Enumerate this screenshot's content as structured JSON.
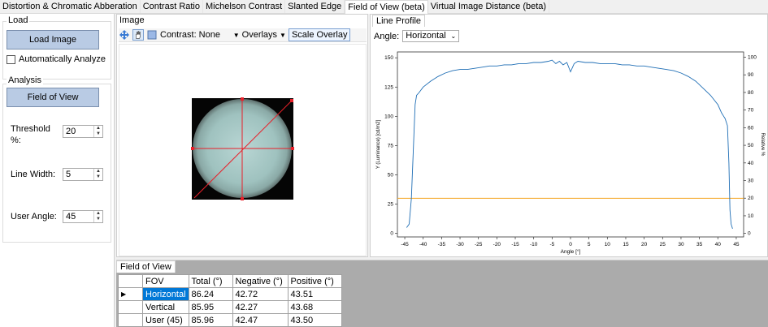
{
  "tabs": [
    "Distortion & Chromatic Abberation",
    "Contrast Ratio",
    "Michelson Contrast",
    "Slanted Edge",
    "Field of View (beta)",
    "Virtual Image Distance (beta)"
  ],
  "active_tab_index": 4,
  "left": {
    "load_group_title": "Load",
    "load_button": "Load Image",
    "auto_analyze_label": "Automatically Analyze",
    "auto_analyze_checked": false,
    "analysis_group_title": "Analysis",
    "fov_button": "Field of View",
    "threshold_label": "Threshold\n%:",
    "threshold_value": "20",
    "line_width_label": "Line Width:",
    "line_width_value": "5",
    "user_angle_label": "User Angle:",
    "user_angle_value": "45"
  },
  "image_panel": {
    "title": "Image",
    "contrast_label": "Contrast:",
    "contrast_value": "None",
    "overlays_label": "Overlays",
    "scale_overlay_label": "Scale Overlay"
  },
  "profile_panel": {
    "tab_label": "Line Profile",
    "angle_label": "Angle:",
    "angle_value": "Horizontal"
  },
  "chart_data": {
    "type": "line",
    "title": "",
    "xlabel": "Angle [°]",
    "ylabel": "Y (Luminance) [cd/m2]",
    "y2label": "Relative %",
    "xlim": [
      -47,
      47
    ],
    "ylim": [
      -3,
      155
    ],
    "y2lim": [
      -2,
      103
    ],
    "x_ticks": [
      -45,
      -40,
      -35,
      -30,
      -25,
      -20,
      -15,
      -10,
      -5,
      0,
      5,
      10,
      15,
      20,
      25,
      30,
      35,
      40,
      45
    ],
    "y_ticks": [
      0,
      25,
      50,
      75,
      100,
      125,
      150
    ],
    "y2_ticks": [
      0,
      10,
      20,
      30,
      40,
      50,
      60,
      70,
      80,
      90,
      100
    ],
    "threshold_line": 30,
    "threshold_color": "#f5a623",
    "series_color": "#1f6eb5",
    "series": [
      {
        "x": [
          -44.5,
          -43.8,
          -43.2,
          -42.7,
          -42.2,
          -41.8,
          -41.2,
          -40,
          -38,
          -36,
          -34,
          -32,
          -30,
          -28,
          -26,
          -24,
          -22,
          -20,
          -18,
          -16,
          -14,
          -12,
          -10,
          -8,
          -6,
          -5,
          -4,
          -3,
          -2,
          -1,
          0,
          1,
          2,
          4,
          6,
          8,
          10,
          12,
          14,
          16,
          18,
          20,
          22,
          24,
          26,
          28,
          30,
          32,
          34,
          36,
          38,
          40,
          41,
          42,
          42.6,
          43.0,
          43.3,
          43.6,
          44.0
        ],
        "y": [
          5,
          8,
          30,
          70,
          110,
          118,
          120,
          125,
          130,
          134,
          137,
          139,
          140,
          140,
          141,
          142,
          143,
          143,
          144,
          144,
          145,
          145,
          146,
          146,
          147,
          148,
          145,
          147,
          144,
          146,
          138,
          145,
          147,
          146,
          146,
          145,
          145,
          145,
          144,
          144,
          143,
          143,
          142,
          141,
          140,
          139,
          137,
          134,
          130,
          124,
          118,
          110,
          103,
          98,
          92,
          60,
          20,
          8,
          4
        ]
      }
    ]
  },
  "table": {
    "title": "Field of View",
    "headers": [
      "FOV",
      "Total (°)",
      "Negative (°)",
      "Positive (°)"
    ],
    "rows": [
      {
        "fov": "Horizontal",
        "total": "86.24",
        "negative": "42.72",
        "positive": "43.51",
        "selected": true
      },
      {
        "fov": "Vertical",
        "total": "85.95",
        "negative": "42.27",
        "positive": "43.68",
        "selected": false
      },
      {
        "fov": "User (45)",
        "total": "85.96",
        "negative": "42.47",
        "positive": "43.50",
        "selected": false
      }
    ]
  },
  "colors": {
    "button_blue": "#b9cbe4",
    "selected_row": "#0078d7",
    "overlay_red": "#e8202a"
  }
}
